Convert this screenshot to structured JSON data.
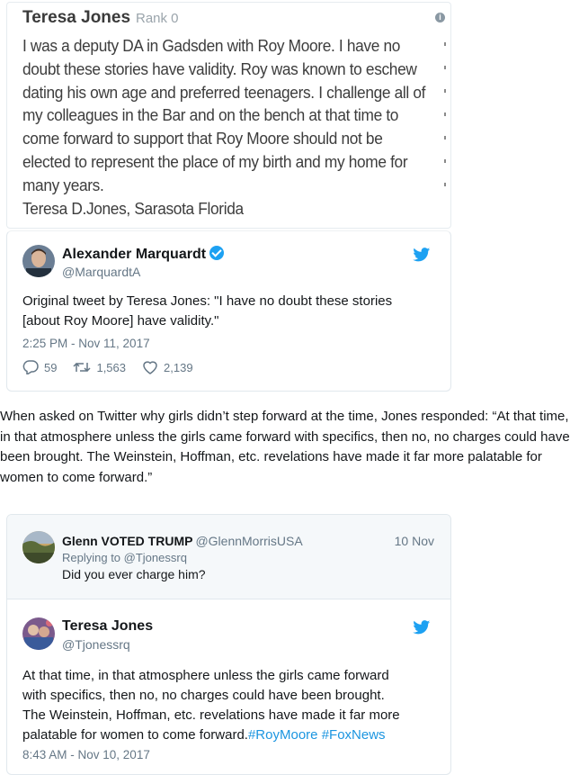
{
  "comment_screenshot": {
    "author": "Teresa Jones",
    "rank": "Rank 0",
    "body": "I was a deputy DA in Gadsden with Roy Moore. I have no doubt these stories have validity. Roy was known to eschew dating his own age and preferred teenagers. I challenge all of my colleagues in the Bar and on the bench at that time to come forward to support that Roy Moore should not be elected to represent the place of my birth and my home for many years.",
    "signature": "Teresa D.Jones, Sarasota Florida",
    "info_icon": "info-icon"
  },
  "tweet1": {
    "name": "Alexander Marquardt",
    "handle": "@MarquardtA",
    "text_line1": "Original tweet by Teresa Jones: \"I have no doubt these stories",
    "text_line2": "[about Roy Moore] have validity.\"",
    "time": "2:25 PM - Nov 11, 2017",
    "replies": "59",
    "retweets": "1,563",
    "likes": "2,139",
    "icons": [
      "verified-icon",
      "twitter-bird-icon",
      "reply-icon",
      "retweet-icon",
      "heart-icon"
    ]
  },
  "article": {
    "paragraph": "When asked on Twitter why girls didn’t step forward at the time, Jones responded: “At that time, in that atmosphere unless the girls came forward with specifics, then no, no charges could have been brought. The Weinstein, Hoffman, etc. revelations have made it far more palatable for women to come forward.”"
  },
  "tweet2": {
    "reply": {
      "name": "Glenn VOTED TRUMP",
      "handle": "@GlennMorrisUSA",
      "date": "10 Nov",
      "replying_to": "Replying to @Tjonessrq",
      "text": "Did you ever charge him?"
    },
    "name": "Teresa Jones",
    "handle": "@Tjonessrq",
    "text_line1": "At that time, in that atmosphere unless the girls came forward",
    "text_line2": "with specifics, then no, no charges could have been brought.",
    "text_line3": "The Weinstein, Hoffman, etc. revelations have made it far more",
    "text_line4": "palatable for women to come forward.",
    "hashtag1": "#RoyMoore",
    "hashtag2": "#FoxNews",
    "time": "8:43 AM - Nov 10, 2017"
  },
  "colors": {
    "twitter_blue": "#1da1f2",
    "link_blue": "#1b95e0",
    "muted_gray": "#657786"
  }
}
